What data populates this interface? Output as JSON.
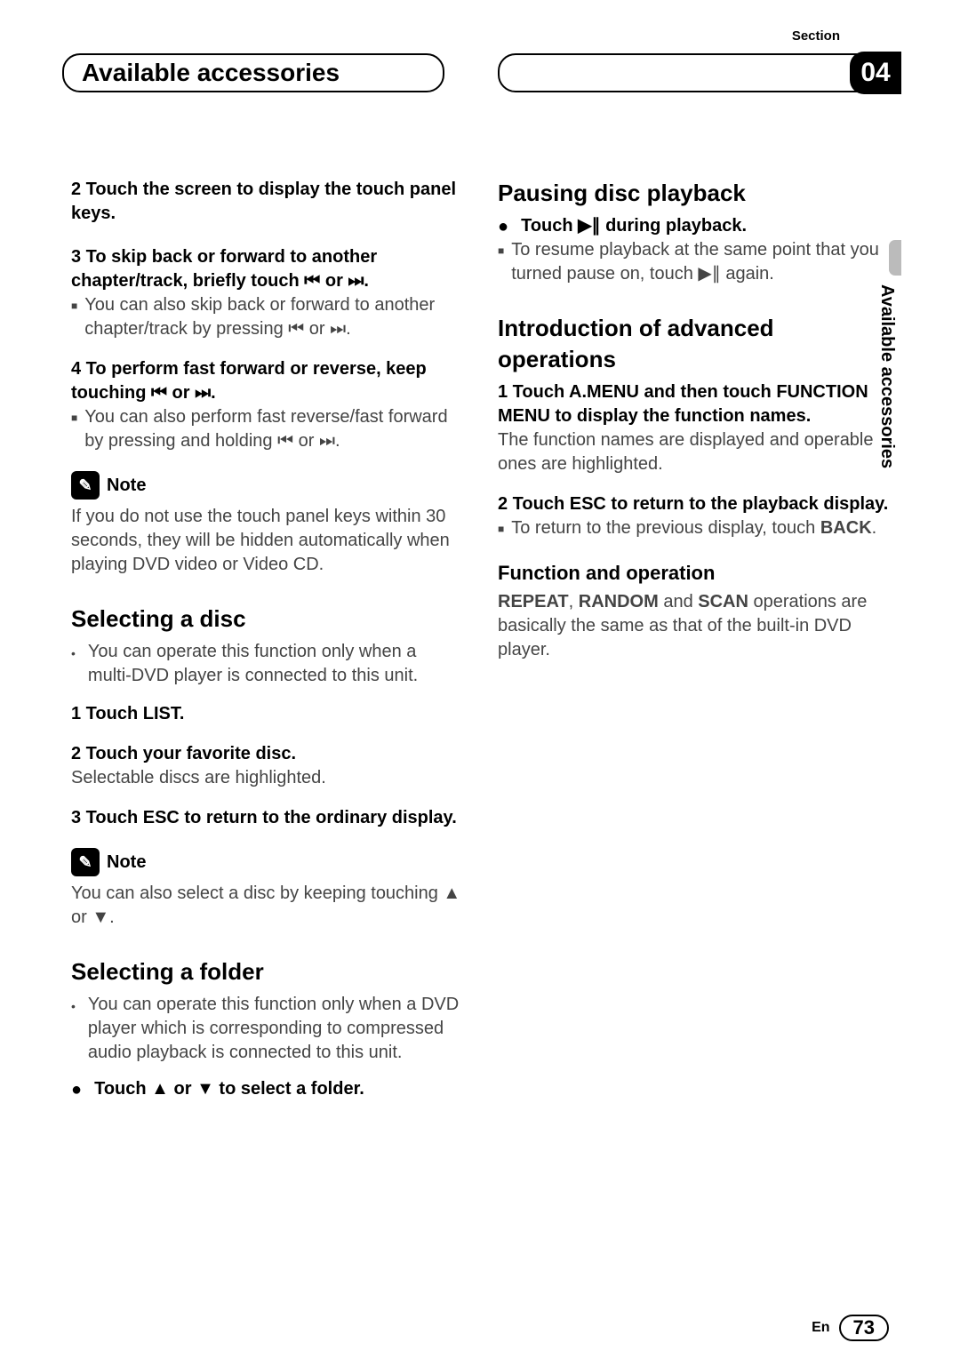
{
  "header": {
    "section_label": "Section",
    "chapter_title": "Available accessories",
    "chapter_number": "04",
    "side_tab": "Available accessories"
  },
  "left": {
    "step2": "2    Touch the screen to display the touch panel keys.",
    "step3_bold": "3    To skip back or forward to another chapter/track, briefly touch ⏮ or ⏭.",
    "step3_bul": "You can also skip back or forward to another chapter/track by pressing ⏮ or ⏭.",
    "step4_bold": "4    To perform fast forward or reverse, keep touching ⏮ or ⏭.",
    "step4_bul": "You can also perform fast reverse/fast forward by pressing and holding ⏮ or ⏭.",
    "note_label": "Note",
    "note1_body": "If you do not use the touch panel keys within 30 seconds, they will be hidden automatically when playing DVD video or Video CD.",
    "h_select_disc": "Selecting a disc",
    "disc_bul": "You can operate this function only when a multi-DVD player is connected to this unit.",
    "disc_s1": "1    Touch LIST.",
    "disc_s2": "2    Touch your favorite disc.",
    "disc_s2_body": "Selectable discs are highlighted.",
    "disc_s3": "3    Touch ESC to return to the ordinary display.",
    "note2_body": "You can also select a disc by keeping touching ▲ or ▼.",
    "h_select_folder": "Selecting a folder",
    "folder_bul": "You can operate this function only when a DVD player which is corresponding to compressed audio playback is connected to this unit.",
    "folder_act": "Touch ▲ or ▼ to select a folder."
  },
  "right": {
    "h_pause": "Pausing disc playback",
    "pause_act": "Touch ▶∥ during playback.",
    "pause_bul": "To resume playback at the same point that you turned pause on, touch ▶∥ again.",
    "h_adv": "Introduction of advanced operations",
    "adv_s1": "1    Touch A.MENU and then touch FUNCTION MENU to display the function names.",
    "adv_s1_body": "The function names are displayed and operable ones are highlighted.",
    "adv_s2": "2    Touch ESC to return to the playback display.",
    "adv_s2_bul_pre": "To return to the previous display, touch ",
    "adv_s2_bul_bold": "BACK",
    "adv_s2_bul_post": ".",
    "h_fo": "Function and operation",
    "fo_body_pre1": "REPEAT",
    "fo_body_mid1": ", ",
    "fo_body_pre2": "RANDOM",
    "fo_body_mid2": " and ",
    "fo_body_pre3": "SCAN",
    "fo_body_post": " operations are basically the same as that of the built-in DVD player."
  },
  "footer": {
    "lang": "En",
    "page": "73"
  }
}
